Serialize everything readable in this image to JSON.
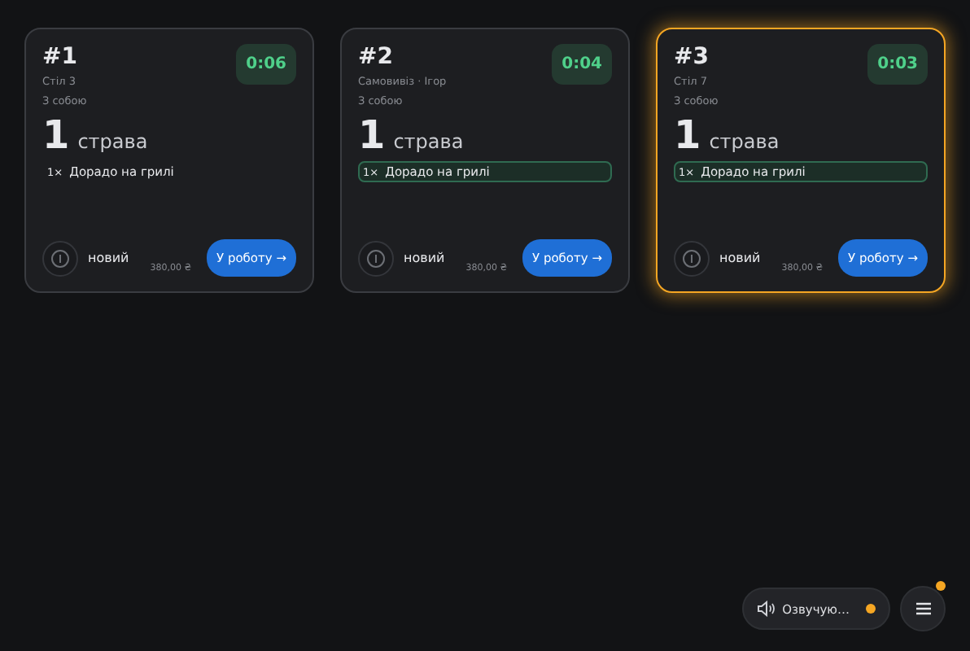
{
  "orders": [
    {
      "number": "#1",
      "place": "Стіл 3",
      "type": "З собою",
      "timer": "0:06",
      "count": "1",
      "count_unit": "страва",
      "selected": false,
      "items": [
        {
          "qty": "1×",
          "name": "Дорадо на грилі",
          "highlighted": false
        }
      ],
      "status": "новий",
      "total": "380,00 ₴",
      "action": "У роботу →"
    },
    {
      "number": "#2",
      "place": "Самовивіз · Ігор",
      "type": "З собою",
      "timer": "0:04",
      "count": "1",
      "count_unit": "страва",
      "selected": false,
      "items": [
        {
          "qty": "1×",
          "name": "Дорадо на грилі",
          "highlighted": true
        }
      ],
      "status": "новий",
      "total": "380,00 ₴",
      "action": "У роботу →"
    },
    {
      "number": "#3",
      "place": "Стіл 7",
      "type": "З собою",
      "timer": "0:03",
      "count": "1",
      "count_unit": "страва",
      "selected": true,
      "items": [
        {
          "qty": "1×",
          "name": "Дорадо на грилі",
          "highlighted": true
        }
      ],
      "status": "новий",
      "total": "380,00 ₴",
      "action": "У роботу →"
    }
  ],
  "voice_button": {
    "label": "Озвучую…",
    "active": true
  },
  "menu_button": {
    "badge": true
  }
}
